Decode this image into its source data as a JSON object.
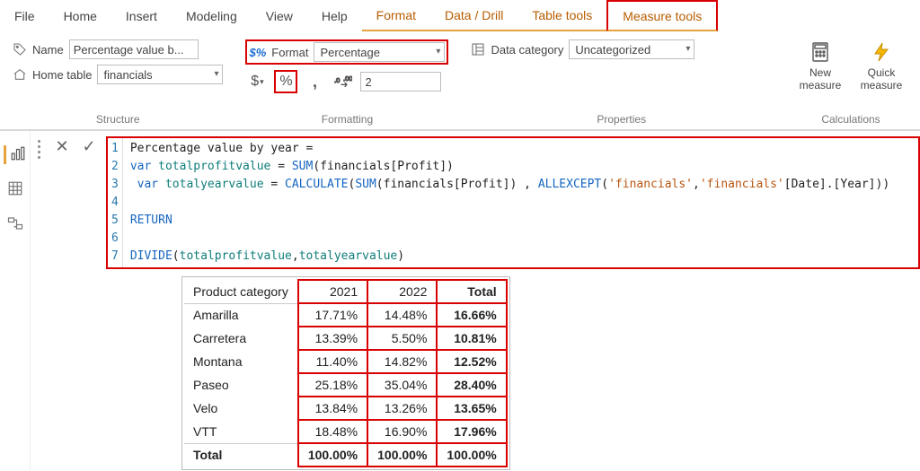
{
  "tabs": {
    "file": "File",
    "home": "Home",
    "insert": "Insert",
    "modeling": "Modeling",
    "view": "View",
    "help": "Help",
    "format": "Format",
    "data_drill": "Data / Drill",
    "table_tools": "Table tools",
    "measure_tools": "Measure tools"
  },
  "structure": {
    "name_label": "Name",
    "name_value": "Percentage value b...",
    "home_table_label": "Home table",
    "home_table_value": "financials",
    "group_label": "Structure"
  },
  "formatting": {
    "format_label": "Format",
    "format_value": "Percentage",
    "decimals_value": "2",
    "group_label": "Formatting",
    "currency_btn": "$",
    "percent_btn": "%",
    "thousands_btn": ","
  },
  "properties": {
    "data_category_label": "Data category",
    "data_category_value": "Uncategorized",
    "group_label": "Properties"
  },
  "calculations": {
    "new_measure": "New measure",
    "quick_measure": "Quick measure",
    "group_label": "Calculations"
  },
  "formula": {
    "lines": [
      {
        "n": "1",
        "raw": "Percentage value by year ="
      },
      {
        "n": "2",
        "raw": "var totalprofitvalue = SUM(financials[Profit])"
      },
      {
        "n": "3",
        "raw": " var totalyearvalue = CALCULATE(SUM(financials[Profit]) , ALLEXCEPT('financials','financials'[Date].[Year]))"
      },
      {
        "n": "4",
        "raw": ""
      },
      {
        "n": "5",
        "raw": "RETURN"
      },
      {
        "n": "6",
        "raw": ""
      },
      {
        "n": "7",
        "raw": "DIVIDE(totalprofitvalue,totalyearvalue)"
      }
    ]
  },
  "chart_data": {
    "type": "table",
    "category_header": "Product category",
    "columns": [
      "2021",
      "2022",
      "Total"
    ],
    "rows": [
      {
        "cat": "Amarilla",
        "v": [
          "17.71%",
          "14.48%",
          "16.66%"
        ]
      },
      {
        "cat": "Carretera",
        "v": [
          "13.39%",
          "5.50%",
          "10.81%"
        ]
      },
      {
        "cat": "Montana",
        "v": [
          "11.40%",
          "14.82%",
          "12.52%"
        ]
      },
      {
        "cat": "Paseo",
        "v": [
          "25.18%",
          "35.04%",
          "28.40%"
        ]
      },
      {
        "cat": "Velo",
        "v": [
          "13.84%",
          "13.26%",
          "13.65%"
        ]
      },
      {
        "cat": "VTT",
        "v": [
          "18.48%",
          "16.90%",
          "17.96%"
        ]
      }
    ],
    "total_row": {
      "cat": "Total",
      "v": [
        "100.00%",
        "100.00%",
        "100.00%"
      ]
    }
  }
}
